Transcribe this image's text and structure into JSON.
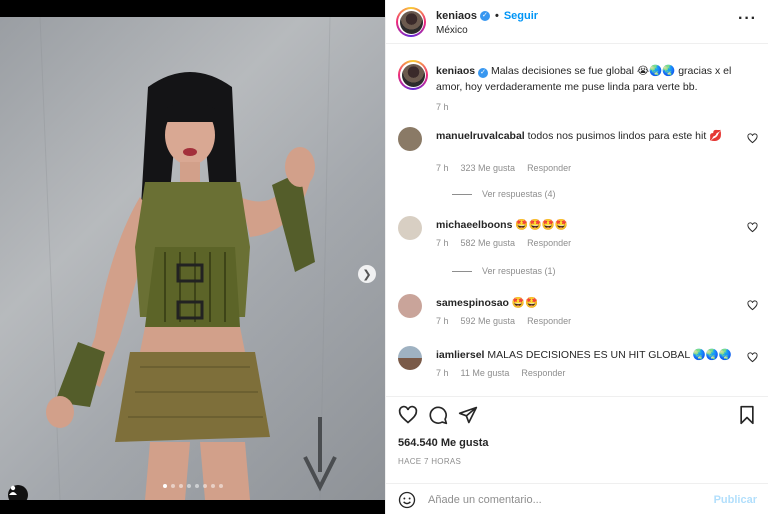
{
  "post": {
    "username": "keniaos",
    "follow_label": "Seguir",
    "location": "México",
    "more_icon": "more-horizontal-icon"
  },
  "caption": {
    "username": "keniaos",
    "text": "Malas decisiones se fue global 😭🌏🌏 gracias x el amor, hoy verdaderamente me puse linda para verte bb.",
    "time": "7 h"
  },
  "comments": [
    {
      "username": "manuelruvalcabal",
      "text": "todos nos pusimos lindos para este hit 💋",
      "time": "7 h",
      "likes": "323 Me gusta",
      "reply": "Responder",
      "replies": "Ver respuestas (4)"
    },
    {
      "username": "michaeelboons",
      "text": "🤩🤩🤩🤩",
      "time": "7 h",
      "likes": "582 Me gusta",
      "reply": "Responder",
      "replies": "Ver respuestas (1)"
    },
    {
      "username": "samespinosao",
      "text": "🤩🤩",
      "time": "7 h",
      "likes": "592 Me gusta",
      "reply": "Responder"
    },
    {
      "username": "iamliersel",
      "text": "MALAS DECISIONES ES UN HIT GLOBAL 🌏🌏🌏",
      "time": "7 h",
      "likes": "11 Me gusta",
      "reply": "Responder"
    }
  ],
  "footer": {
    "likes": "564.540 Me gusta",
    "ago": "HACE 7 HORAS",
    "comment_placeholder": "Añade un comentario...",
    "publish_label": "Publicar"
  },
  "carousel": {
    "slides": 8,
    "active_index": 0
  },
  "colors": {
    "accent": "#0095f6",
    "publish_disabled": "#b2dffc",
    "muted_text": "#8e8e8e",
    "verified": "#3897f0"
  },
  "icons": {
    "like": "heart-icon",
    "comment": "comment-icon",
    "share": "paper-plane-icon",
    "save": "bookmark-icon",
    "emoji": "smiley-icon",
    "next": "chevron-right-icon",
    "tag": "user-tag-icon"
  }
}
